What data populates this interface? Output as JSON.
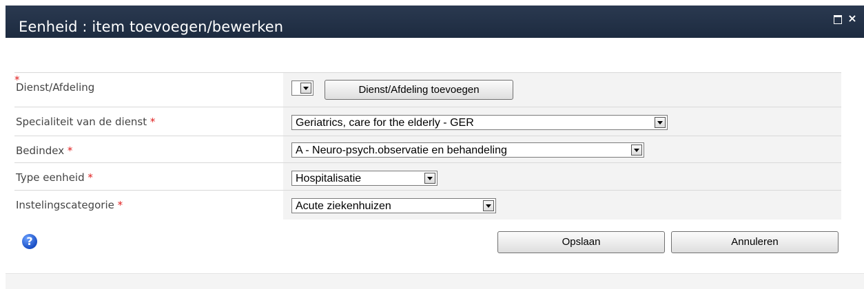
{
  "dialog": {
    "title": "Eenheid : item toevoegen/bewerken",
    "maximize_icon": "maximize-icon",
    "close_icon": "close-icon",
    "close_glyph": "×"
  },
  "form": {
    "required_marker": "*",
    "rows": [
      {
        "label": "Dienst/Afdeling",
        "value": "",
        "button": "Dienst/Afdeling toevoegen"
      },
      {
        "label": "Specialiteit van de dienst",
        "value": "Geriatrics, care for the elderly - GER"
      },
      {
        "label": "Bedindex",
        "value": "A - Neuro-psych.observatie en behandeling"
      },
      {
        "label": "Type eenheid",
        "value": "Hospitalisatie"
      },
      {
        "label": "Instelingscategorie",
        "value": "Acute ziekenhuizen"
      }
    ]
  },
  "actions": {
    "help_icon": "help-icon",
    "help_glyph": "?",
    "save_label": "Opslaan",
    "cancel_label": "Annuleren"
  },
  "colors": {
    "titlebar": "#1f2d42",
    "required": "#e02020",
    "field_bg": "#f3f3f3"
  }
}
